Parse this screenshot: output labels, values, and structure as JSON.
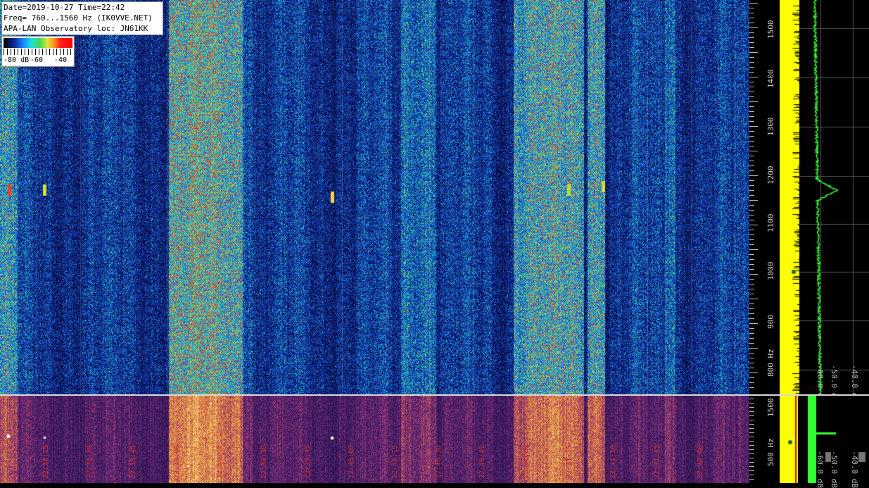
{
  "info": {
    "line1": "Date=2019-10-27 Time=22:42",
    "line2": "Freq= 760...1560 Hz (IK0VVE.NET)",
    "line3": "APA-LAN Observatory loc: JN61KK"
  },
  "scale": {
    "labels": [
      "-80 dB",
      "-60",
      "-40"
    ]
  },
  "freq_axis": {
    "labels": [
      "1500",
      "1400",
      "1300",
      "1200",
      "1100",
      "1000",
      "900",
      "800 Hz"
    ]
  },
  "freq_axis_lower": {
    "labels": [
      "1500",
      "500 Hz"
    ]
  },
  "profile": {
    "db_labels": [
      "-60.0 dB",
      "-50.0 dB",
      "-40.0 dB"
    ]
  },
  "profile_lower": {
    "db_labels": [
      "-60.0 dB",
      "-50.0 dB",
      "-40.0 dB"
    ]
  },
  "time_labels": [
    "22:38:15",
    "22:38:30",
    "22:38:45",
    "22:39:00",
    "22:39:15",
    "22:39:30",
    "22:39:45",
    "22:40:00",
    "22:40:15",
    "22:40:30",
    "22:40:45",
    "22:41:00",
    "22:41:15",
    "22:41:30",
    "22:41:45",
    "22:42:00"
  ],
  "colors": {
    "background": "#030620",
    "profile_fill": "#ffff00",
    "profile_line": "#33ff33",
    "lower_bg": "#1e1036",
    "time_label": "#c83030"
  }
}
